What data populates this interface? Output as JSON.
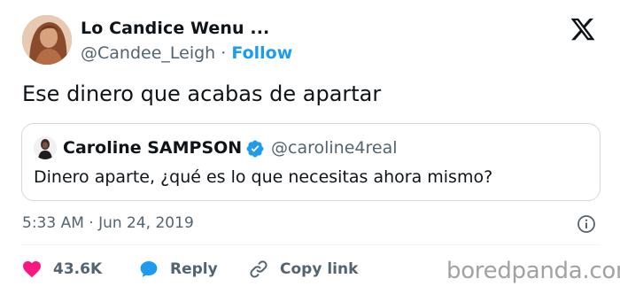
{
  "author": {
    "name": "Lo Candice Wenu ...",
    "handle": "@Candee_Leigh",
    "separator": "·",
    "follow_label": "Follow"
  },
  "tweet": {
    "text": "Ese dinero que acabas de apartar",
    "timestamp": "5:33 AM · Jun 24, 2019"
  },
  "quoted": {
    "name": "Caroline SAMPSON",
    "handle": "@caroline4real",
    "text": "Dinero aparte, ¿qué es lo que necesitas ahora mismo?",
    "verified_icon": "verified-badge-icon"
  },
  "actions": {
    "likes": "43.6K",
    "reply_label": "Reply",
    "copy_label": "Copy link"
  },
  "watermark": "boredpanda.com",
  "colors": {
    "accent": "#1d9bf0",
    "like": "#f91880",
    "muted": "#536471",
    "text": "#0f1419",
    "border": "#cfd9de"
  },
  "icons": {
    "brand": "x-logo-icon",
    "info": "info-icon",
    "like": "heart-icon",
    "reply": "speech-bubble-icon",
    "copy": "link-icon"
  }
}
